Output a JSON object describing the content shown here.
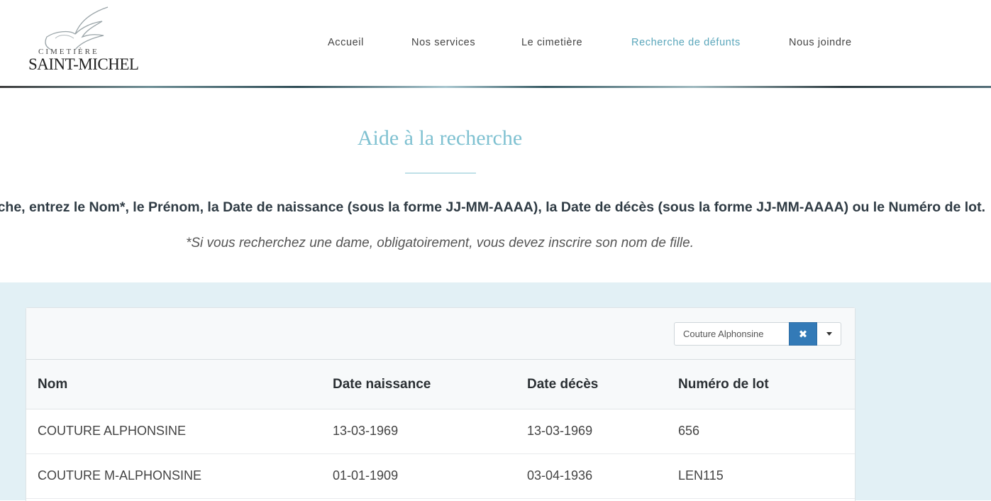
{
  "logo": {
    "top_text": "CIMETIÈRE",
    "main_text": "SAINT-MICHEL"
  },
  "nav": {
    "items": [
      {
        "label": "Accueil",
        "active": false
      },
      {
        "label": "Nos services",
        "active": false
      },
      {
        "label": "Le cimetière",
        "active": false
      },
      {
        "label": "Recherche de défunts",
        "active": true
      },
      {
        "label": "Nous joindre",
        "active": false
      }
    ]
  },
  "intro": {
    "title": "Aide à la recherche",
    "instructions": "echerche, entrez le Nom*, le Prénom, la Date de naissance (sous la forme JJ-MM-AAAA), la Date de décès (sous la forme JJ-MM-AAAA) ou le Numéro de lot.",
    "note": "*Si vous recherchez une dame, obligatoirement, vous devez inscrire son nom de fille."
  },
  "search": {
    "value": "Couture Alphonsine",
    "clear_icon": "✖"
  },
  "table": {
    "columns": [
      "Nom",
      "Date naissance",
      "Date décès",
      "Numéro de lot"
    ],
    "rows": [
      [
        "COUTURE ALPHONSINE",
        "13-03-1969",
        "13-03-1969",
        "656"
      ],
      [
        "COUTURE M-ALPHONSINE",
        "01-01-1909",
        "03-04-1936",
        "LEN115"
      ]
    ]
  },
  "colors": {
    "accent": "#7fc1d1",
    "nav_active": "#5aa6bb",
    "button": "#337ab7",
    "results_bg": "#e2f0f5"
  }
}
